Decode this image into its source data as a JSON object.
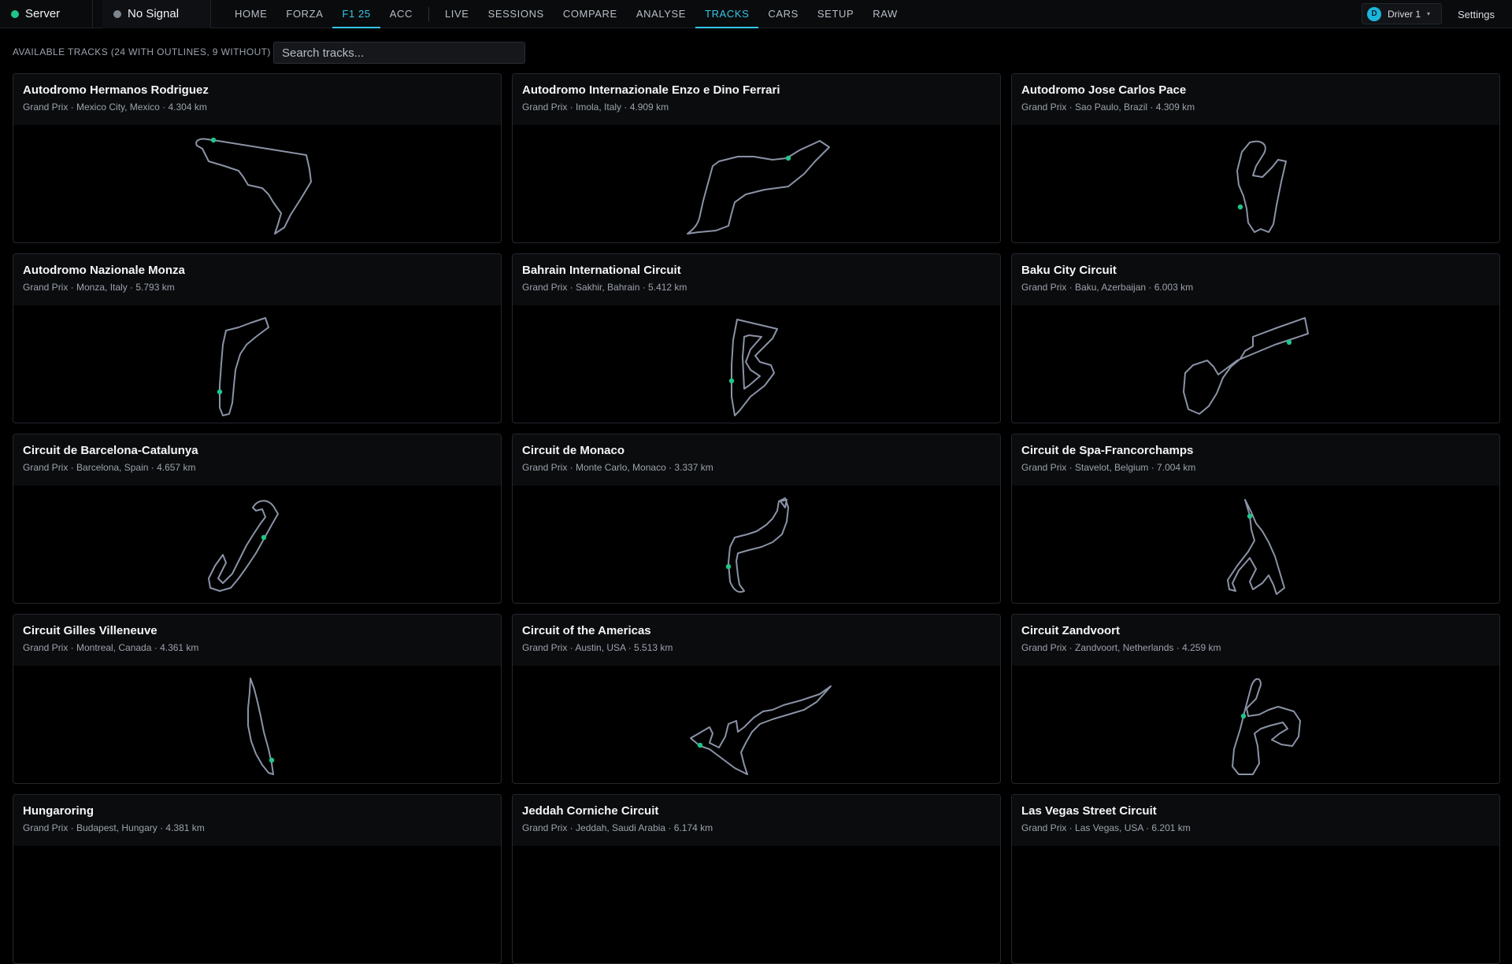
{
  "status": {
    "server_label": "Server",
    "server_color": "#20c58a",
    "signal_label": "No Signal",
    "signal_color": "#7d8590"
  },
  "nav": {
    "primary": [
      "HOME",
      "FORZA",
      "F1 25",
      "ACC"
    ],
    "secondary": [
      "LIVE",
      "SESSIONS",
      "COMPARE",
      "ANALYSE",
      "TRACKS",
      "CARS",
      "SETUP",
      "RAW"
    ],
    "active_game": "F1 25",
    "active_page": "TRACKS",
    "accent_color": "#34c7e8"
  },
  "user": {
    "avatar_letter": "D",
    "driver_name": "Driver 1",
    "settings_label": "Settings"
  },
  "toolbar": {
    "tracks_label": "AVAILABLE TRACKS (24 WITH OUTLINES, 9 WITHOUT)",
    "search_placeholder": "Search tracks..."
  },
  "tracks": [
    {
      "name": "Autodromo Hermanos Rodriguez",
      "subtitle": "Grand Prix · Mexico City, Mexico · 4.304 km",
      "outline": "hermanos-rodriguez"
    },
    {
      "name": "Autodromo Internazionale Enzo e Dino Ferrari",
      "subtitle": "Grand Prix · Imola, Italy · 4.909 km",
      "outline": "imola"
    },
    {
      "name": "Autodromo Jose Carlos Pace",
      "subtitle": "Grand Prix · Sao Paulo, Brazil · 4.309 km",
      "outline": "interlagos"
    },
    {
      "name": "Autodromo Nazionale Monza",
      "subtitle": "Grand Prix · Monza, Italy · 5.793 km",
      "outline": "monza"
    },
    {
      "name": "Bahrain International Circuit",
      "subtitle": "Grand Prix · Sakhir, Bahrain · 5.412 km",
      "outline": "bahrain"
    },
    {
      "name": "Baku City Circuit",
      "subtitle": "Grand Prix · Baku, Azerbaijan · 6.003 km",
      "outline": "baku"
    },
    {
      "name": "Circuit de Barcelona-Catalunya",
      "subtitle": "Grand Prix · Barcelona, Spain · 4.657 km",
      "outline": "barcelona"
    },
    {
      "name": "Circuit de Monaco",
      "subtitle": "Grand Prix · Monte Carlo, Monaco · 3.337 km",
      "outline": "monaco"
    },
    {
      "name": "Circuit de Spa-Francorchamps",
      "subtitle": "Grand Prix · Stavelot, Belgium · 7.004 km",
      "outline": "spa"
    },
    {
      "name": "Circuit Gilles Villeneuve",
      "subtitle": "Grand Prix · Montreal, Canada · 4.361 km",
      "outline": "montreal"
    },
    {
      "name": "Circuit of the Americas",
      "subtitle": "Grand Prix · Austin, USA · 5.513 km",
      "outline": "cota"
    },
    {
      "name": "Circuit Zandvoort",
      "subtitle": "Grand Prix · Zandvoort, Netherlands · 4.259 km",
      "outline": "zandvoort"
    },
    {
      "name": "Hungaroring",
      "subtitle": "Grand Prix · Budapest, Hungary · 4.381 km",
      "outline": "hungaroring"
    },
    {
      "name": "Jeddah Corniche Circuit",
      "subtitle": "Grand Prix · Jeddah, Saudi Arabia · 6.174 km",
      "outline": "jeddah"
    },
    {
      "name": "Las Vegas Street Circuit",
      "subtitle": "Grand Prix · Las Vegas, USA · 6.201 km",
      "outline": "las-vegas"
    }
  ],
  "colors": {
    "track_outline": "#8a93a6",
    "start_marker": "#20c58a"
  }
}
